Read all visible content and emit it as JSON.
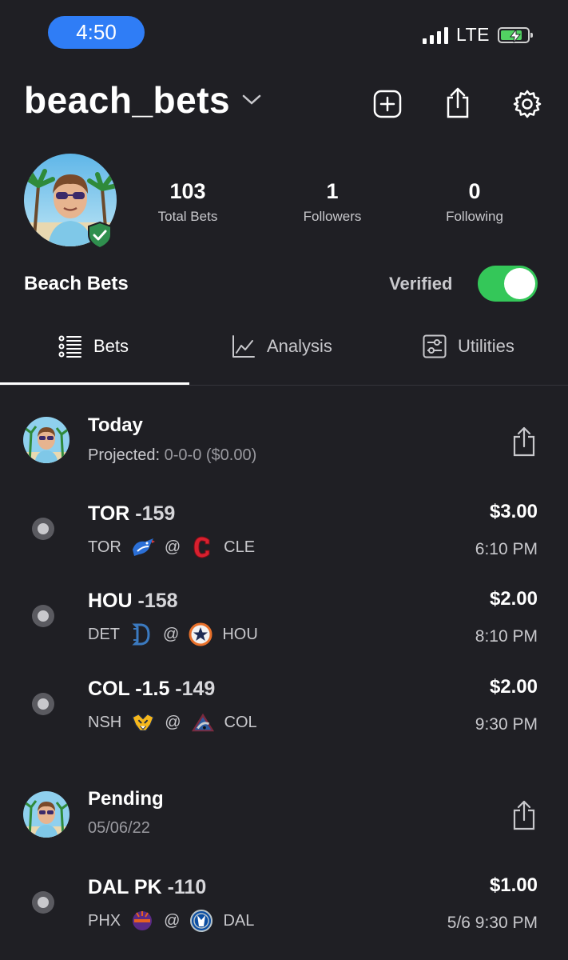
{
  "status_bar": {
    "time": "4:50",
    "network": "LTE"
  },
  "header": {
    "username": "beach_bets"
  },
  "profile": {
    "display_name": "Beach Bets",
    "verified_label": "Verified",
    "verified": true,
    "stats": [
      {
        "value": "103",
        "label": "Total Bets"
      },
      {
        "value": "1",
        "label": "Followers"
      },
      {
        "value": "0",
        "label": "Following"
      }
    ]
  },
  "tabs": [
    {
      "label": "Bets",
      "icon": "list-icon",
      "active": true
    },
    {
      "label": "Analysis",
      "icon": "chart-line-icon",
      "active": false
    },
    {
      "label": "Utilities",
      "icon": "sliders-icon",
      "active": false
    }
  ],
  "groups": {
    "today": {
      "title": "Today",
      "sub_prefix": "Projected:",
      "sub_value": "0-0-0 ($0.00)",
      "bets": [
        {
          "pick": "TOR",
          "odds": "-159",
          "away": "TOR",
          "at": "@",
          "home": "CLE",
          "amount": "$3.00",
          "time": "6:10 PM"
        },
        {
          "pick": "HOU",
          "odds": "-158",
          "away": "DET",
          "at": "@",
          "home": "HOU",
          "amount": "$2.00",
          "time": "8:10 PM"
        },
        {
          "pick": "COL -1.5",
          "odds": "-149",
          "away": "NSH",
          "at": "@",
          "home": "COL",
          "amount": "$2.00",
          "time": "9:30 PM"
        }
      ]
    },
    "pending": {
      "title": "Pending",
      "sub_value": "05/06/22",
      "bets": [
        {
          "pick": "DAL PK",
          "odds": "-110",
          "away": "PHX",
          "at": "@",
          "home": "DAL",
          "amount": "$1.00",
          "time": "5/6 9:30 PM"
        }
      ]
    }
  },
  "colors": {
    "background": "#1f1f24",
    "accent": "#2f7df6",
    "toggle_on": "#34c759",
    "verified_badge": "#2f8f4e"
  }
}
